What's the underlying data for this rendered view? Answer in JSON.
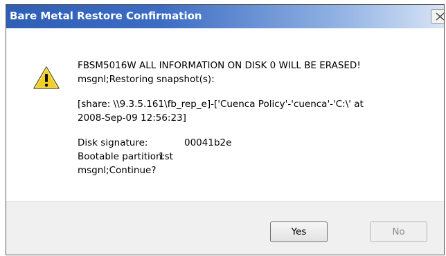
{
  "dialog": {
    "title": "Bare Metal Restore Confirmation",
    "close_icon": "close-icon"
  },
  "message": {
    "icon": "warning-icon",
    "line1": "FBSM5016W  ALL INFORMATION ON DISK 0 WILL BE ERASED!",
    "line2": "msgnl;Restoring snapshot(s):",
    "line3": "[share: \\\\9.3.5.161\\fb_rep_e]-['Cuenca Policy'-'cuenca'-'C:\\' at",
    "line4": "2008-Sep-09 12:56:23]",
    "disk_signature_label": "Disk signature:",
    "disk_signature_value": "00041b2e",
    "bootable_partition_label": "Bootable partition:",
    "bootable_partition_value": "1st",
    "line_continue": "msgnl;Continue?"
  },
  "buttons": {
    "yes": "Yes",
    "no": "No"
  },
  "colors": {
    "title_gradient_start": "#2f5fb5",
    "warning_yellow": "#f2d021",
    "footer_bg": "#f0f0f0"
  }
}
